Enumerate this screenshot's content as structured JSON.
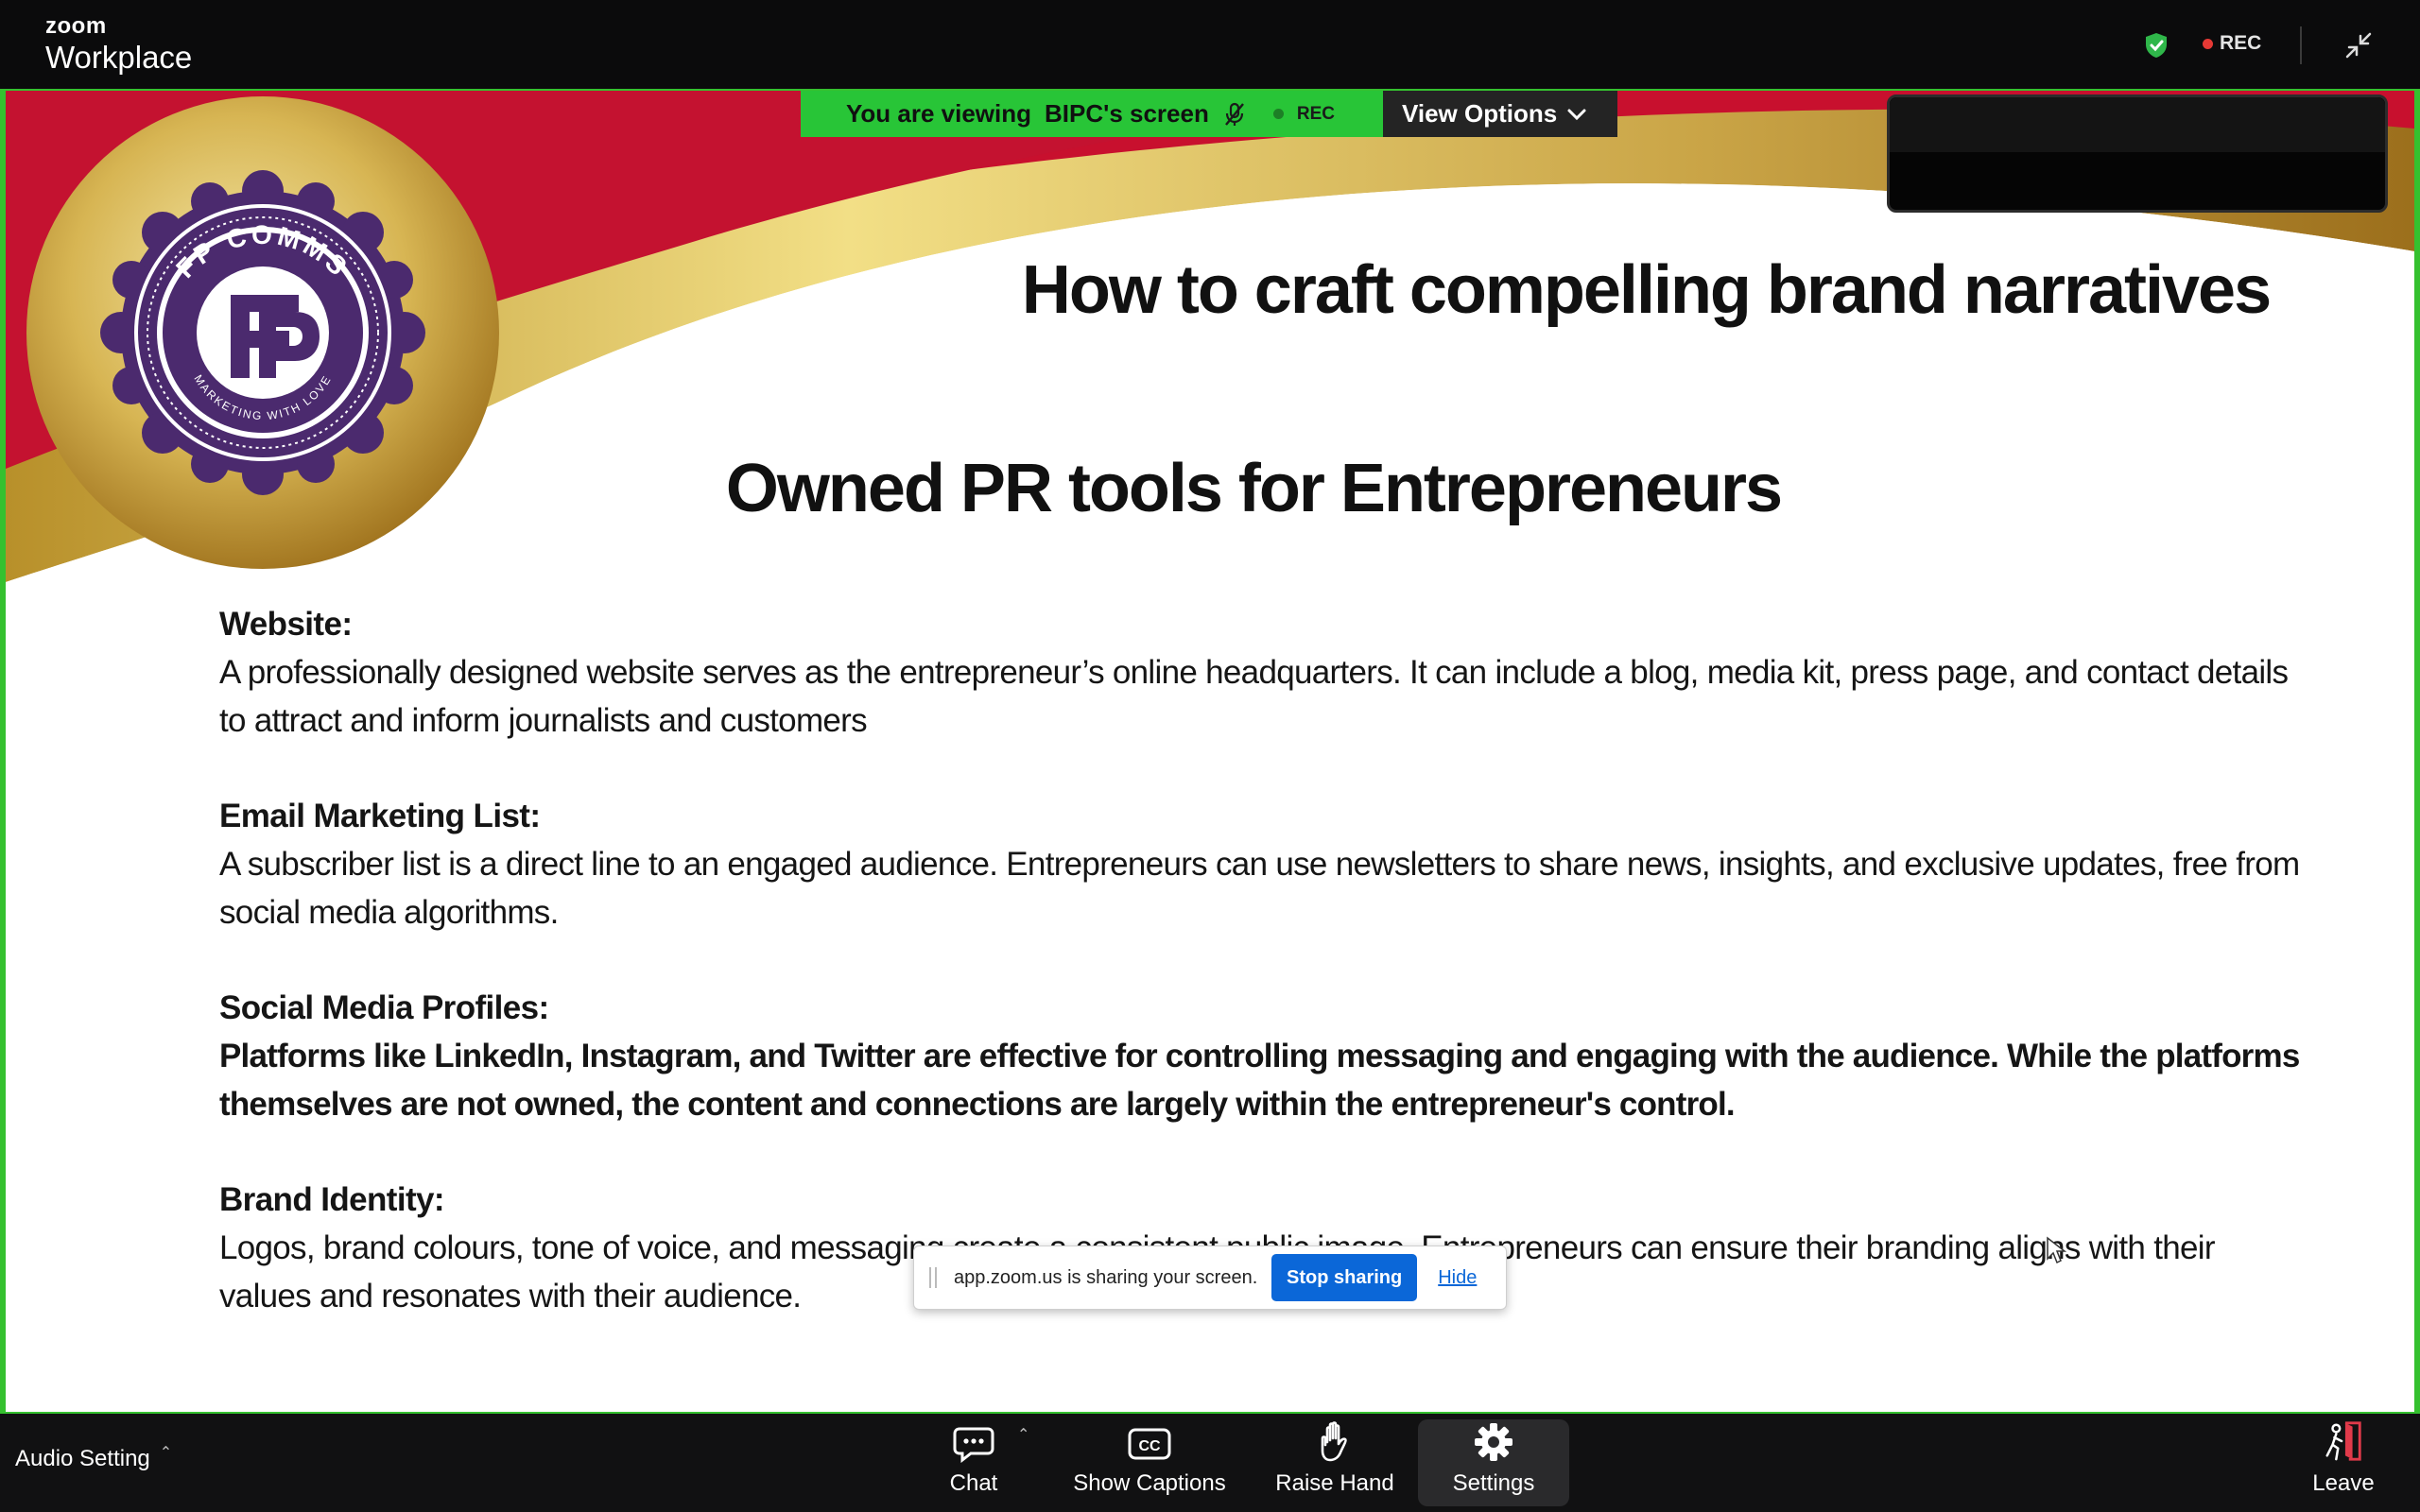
{
  "app": {
    "brand_small": "zoom",
    "brand_large": "Workplace"
  },
  "topbar": {
    "rec_label": "REC",
    "shield_icon": "shield-check-icon",
    "minimize_icon": "minimize-icon"
  },
  "view_banner": {
    "viewing_text": "You are viewing",
    "presenter_text": "BIPC's screen",
    "rec_label": "REC",
    "view_options_label": "View Options"
  },
  "slide": {
    "title": "How to craft compelling brand narratives",
    "subtitle": "Owned PR tools for Entrepreneurs",
    "logo_text_top": "FP COMMS",
    "logo_text_bottom": "MARKETING WITH LOVE",
    "items": [
      {
        "heading": "Website:",
        "body": "A professionally designed website serves as the entrepreneur’s online headquarters. It can include a blog, media kit, press page, and contact details to attract and inform journalists and customers"
      },
      {
        "heading": "Email Marketing List:",
        "body": "A subscriber list is a direct line to an engaged audience. Entrepreneurs can use newsletters to share news, insights, and exclusive updates, free from social media algorithms."
      },
      {
        "heading": "Social Media Profiles:",
        "body": "Platforms like LinkedIn, Instagram, and Twitter are effective for controlling messaging and engaging with the audience. While the platforms themselves are not owned, the content and connections are largely within the entrepreneur's control."
      },
      {
        "heading": "Brand Identity:",
        "body": "Logos, brand colours, tone of voice, and messaging create a consistent public image. Entrepreneurs can ensure their branding aligns with their values and resonates with their audience."
      }
    ]
  },
  "share_popup": {
    "message": "app.zoom.us is sharing your screen.",
    "stop_label": "Stop sharing",
    "hide_label": "Hide"
  },
  "toolbar": {
    "audio_label": "Audio Setting",
    "chat_label": "Chat",
    "captions_label": "Show Captions",
    "raise_label": "Raise Hand",
    "settings_label": "Settings",
    "leave_label": "Leave"
  },
  "colors": {
    "share_border": "#35c12f",
    "banner_green": "#28c537",
    "stop_button": "#0b67d8",
    "swoosh_red": "#c8102e",
    "swoosh_gold": "#d4b24a",
    "logo_purple": "#4b2a6e"
  }
}
